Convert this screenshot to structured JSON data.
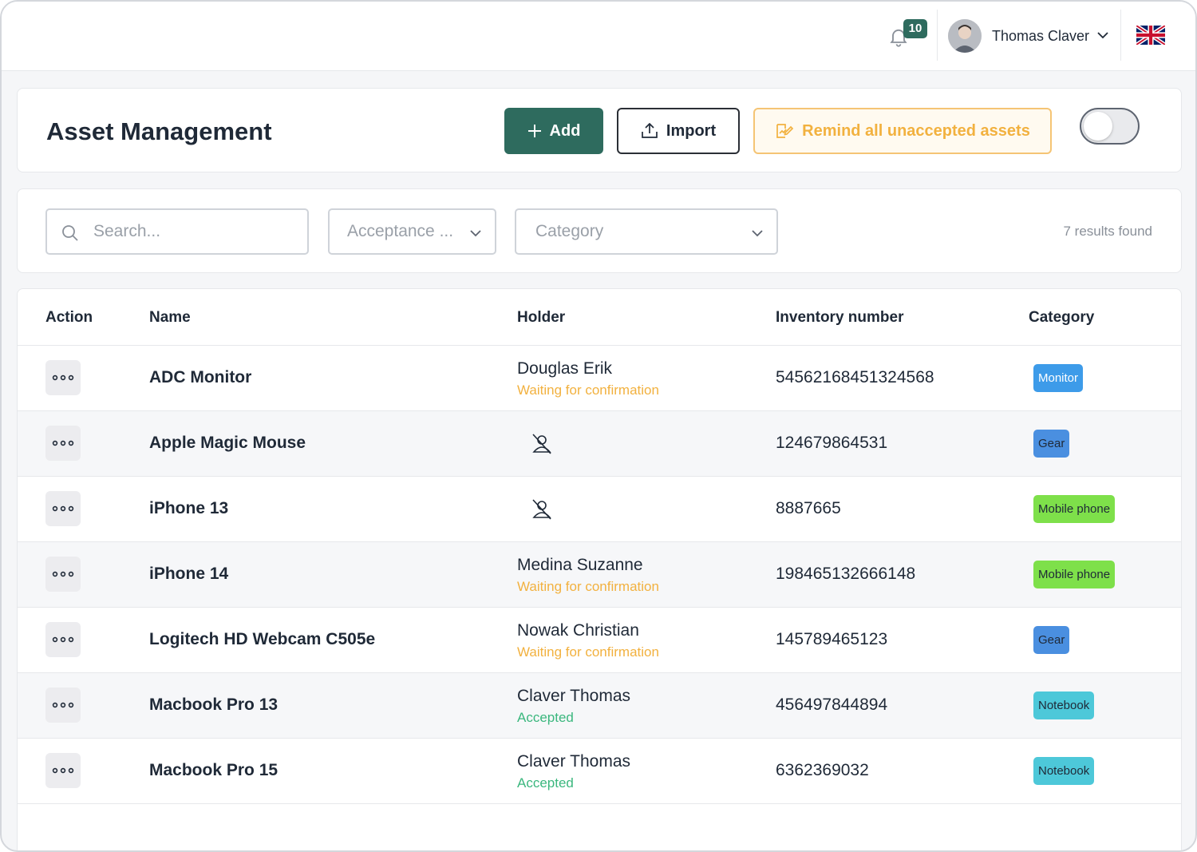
{
  "topbar": {
    "notifications_count": "10",
    "user_name": "Thomas Claver",
    "language": "en-GB"
  },
  "header": {
    "title": "Asset Management",
    "add_label": "Add",
    "import_label": "Import",
    "remind_label": "Remind all unaccepted assets",
    "toggle_on": false
  },
  "filters": {
    "search_placeholder": "Search...",
    "acceptance_placeholder": "Acceptance ...",
    "category_placeholder": "Category",
    "results_text": "7 results found"
  },
  "table": {
    "columns": [
      "Action",
      "Name",
      "Holder",
      "Inventory number",
      "Category"
    ],
    "rows": [
      {
        "name": "ADC Monitor",
        "holder": "Douglas Erik",
        "status": "Waiting for confirmation",
        "status_type": "waiting",
        "inventory": "54562168451324568",
        "category": "Monitor"
      },
      {
        "name": "Apple Magic Mouse",
        "holder": "",
        "status": "",
        "status_type": "none",
        "inventory": "124679864531",
        "category": "Gear"
      },
      {
        "name": "iPhone 13",
        "holder": "",
        "status": "",
        "status_type": "none",
        "inventory": "8887665",
        "category": "Mobile phone"
      },
      {
        "name": "iPhone 14",
        "holder": "Medina Suzanne",
        "status": "Waiting for confirmation",
        "status_type": "waiting",
        "inventory": "198465132666148",
        "category": "Mobile phone"
      },
      {
        "name": "Logitech HD Webcam C505e",
        "holder": "Nowak Christian",
        "status": "Waiting for confirmation",
        "status_type": "waiting",
        "inventory": "145789465123",
        "category": "Gear"
      },
      {
        "name": "Macbook Pro 13",
        "holder": "Claver Thomas",
        "status": "Accepted",
        "status_type": "accepted",
        "inventory": "456497844894",
        "category": "Notebook"
      },
      {
        "name": "Macbook Pro 15",
        "holder": "Claver Thomas",
        "status": "Accepted",
        "status_type": "accepted",
        "inventory": "6362369032",
        "category": "Notebook"
      }
    ]
  },
  "colors": {
    "primary": "#2e6b5e",
    "warning": "#f2b13f",
    "success": "#3bb77e",
    "badge_monitor": "#3d9be9",
    "badge_gear": "#4a8fe0",
    "badge_mobile": "#7ee04a",
    "badge_notebook": "#4dc8d9"
  }
}
